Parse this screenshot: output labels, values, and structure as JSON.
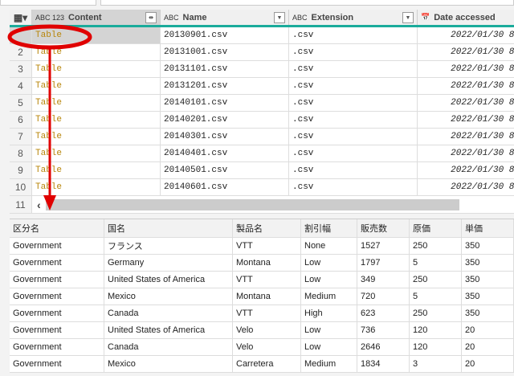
{
  "top_grid": {
    "columns": [
      {
        "type": "ABC 123",
        "label": "Content"
      },
      {
        "type": "ABC",
        "label": "Name"
      },
      {
        "type": "ABC",
        "label": "Extension"
      },
      {
        "type": "datetime",
        "label": "Date accessed"
      }
    ],
    "rows": [
      {
        "n": "",
        "content": "Table",
        "name": "20130901.csv",
        "ext": ".csv",
        "date": "2022/01/30 8:"
      },
      {
        "n": "2",
        "content": "Table",
        "name": "20131001.csv",
        "ext": ".csv",
        "date": "2022/01/30 8:"
      },
      {
        "n": "3",
        "content": "Table",
        "name": "20131101.csv",
        "ext": ".csv",
        "date": "2022/01/30 8:"
      },
      {
        "n": "4",
        "content": "Table",
        "name": "20131201.csv",
        "ext": ".csv",
        "date": "2022/01/30 8:"
      },
      {
        "n": "5",
        "content": "Table",
        "name": "20140101.csv",
        "ext": ".csv",
        "date": "2022/01/30 8:"
      },
      {
        "n": "6",
        "content": "Table",
        "name": "20140201.csv",
        "ext": ".csv",
        "date": "2022/01/30 8:"
      },
      {
        "n": "7",
        "content": "Table",
        "name": "20140301.csv",
        "ext": ".csv",
        "date": "2022/01/30 8:"
      },
      {
        "n": "8",
        "content": "Table",
        "name": "20140401.csv",
        "ext": ".csv",
        "date": "2022/01/30 8:"
      },
      {
        "n": "9",
        "content": "Table",
        "name": "20140501.csv",
        "ext": ".csv",
        "date": "2022/01/30 8:"
      },
      {
        "n": "10",
        "content": "Table",
        "name": "20140601.csv",
        "ext": ".csv",
        "date": "2022/01/30 8:"
      }
    ],
    "last_row_number": "11"
  },
  "preview": {
    "headers": [
      "区分名",
      "国名",
      "製品名",
      "割引幅",
      "販売数",
      "原価",
      "単価"
    ],
    "rows": [
      [
        "Government",
        "フランス",
        "VTT",
        "None",
        "1527",
        "250",
        "350"
      ],
      [
        "Government",
        "Germany",
        "Montana",
        "Low",
        "1797",
        "5",
        "350"
      ],
      [
        "Government",
        "United States of America",
        "VTT",
        "Low",
        "349",
        "250",
        "350"
      ],
      [
        "Government",
        "Mexico",
        "Montana",
        "Medium",
        "720",
        "5",
        "350"
      ],
      [
        "Government",
        "Canada",
        "VTT",
        "High",
        "623",
        "250",
        "350"
      ],
      [
        "Government",
        "United States of America",
        "Velo",
        "Low",
        "736",
        "120",
        "20"
      ],
      [
        "Government",
        "Canada",
        "Velo",
        "Low",
        "2646",
        "120",
        "20"
      ],
      [
        "Government",
        "Mexico",
        "Carretera",
        "Medium",
        "1834",
        "3",
        "20"
      ]
    ]
  },
  "colors": {
    "accent": "#1aab9b",
    "annotation": "#e00000",
    "table_link": "#b8860b"
  }
}
